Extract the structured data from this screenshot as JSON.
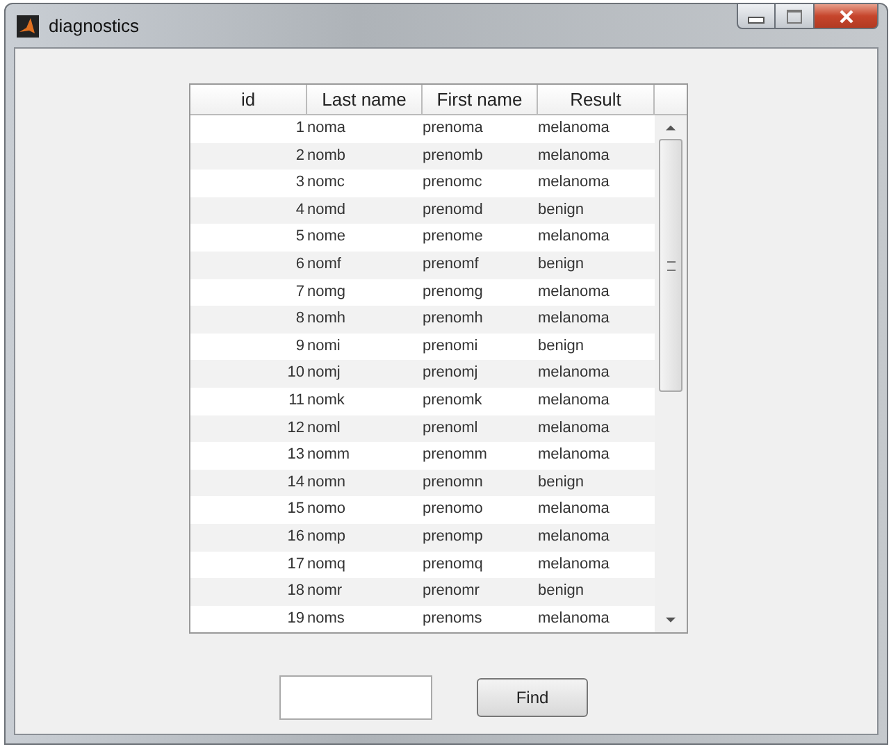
{
  "window": {
    "title": "diagnostics"
  },
  "table": {
    "columns": [
      "id",
      "Last name",
      "First name",
      "Result"
    ],
    "rows": [
      [
        "1",
        "noma",
        "prenoma",
        "melanoma"
      ],
      [
        "2",
        "nomb",
        "prenomb",
        "melanoma"
      ],
      [
        "3",
        "nomc",
        "prenomc",
        "melanoma"
      ],
      [
        "4",
        "nomd",
        "prenomd",
        "benign"
      ],
      [
        "5",
        "nome",
        "prenome",
        "melanoma"
      ],
      [
        "6",
        "nomf",
        "prenomf",
        "benign"
      ],
      [
        "7",
        "nomg",
        "prenomg",
        "melanoma"
      ],
      [
        "8",
        "nomh",
        "prenomh",
        "melanoma"
      ],
      [
        "9",
        "nomi",
        "prenomi",
        "benign"
      ],
      [
        "10",
        "nomj",
        "prenomj",
        "melanoma"
      ],
      [
        "11",
        "nomk",
        "prenomk",
        "melanoma"
      ],
      [
        "12",
        "noml",
        "prenoml",
        "melanoma"
      ],
      [
        "13",
        "nomm",
        "prenomm",
        "melanoma"
      ],
      [
        "14",
        "nomn",
        "prenomn",
        "benign"
      ],
      [
        "15",
        "nomo",
        "prenomo",
        "melanoma"
      ],
      [
        "16",
        "nomp",
        "prenomp",
        "melanoma"
      ],
      [
        "17",
        "nomq",
        "prenomq",
        "melanoma"
      ],
      [
        "18",
        "nomr",
        "prenomr",
        "benign"
      ],
      [
        "19",
        "noms",
        "prenoms",
        "melanoma"
      ]
    ]
  },
  "find_button": {
    "label": "Find"
  }
}
